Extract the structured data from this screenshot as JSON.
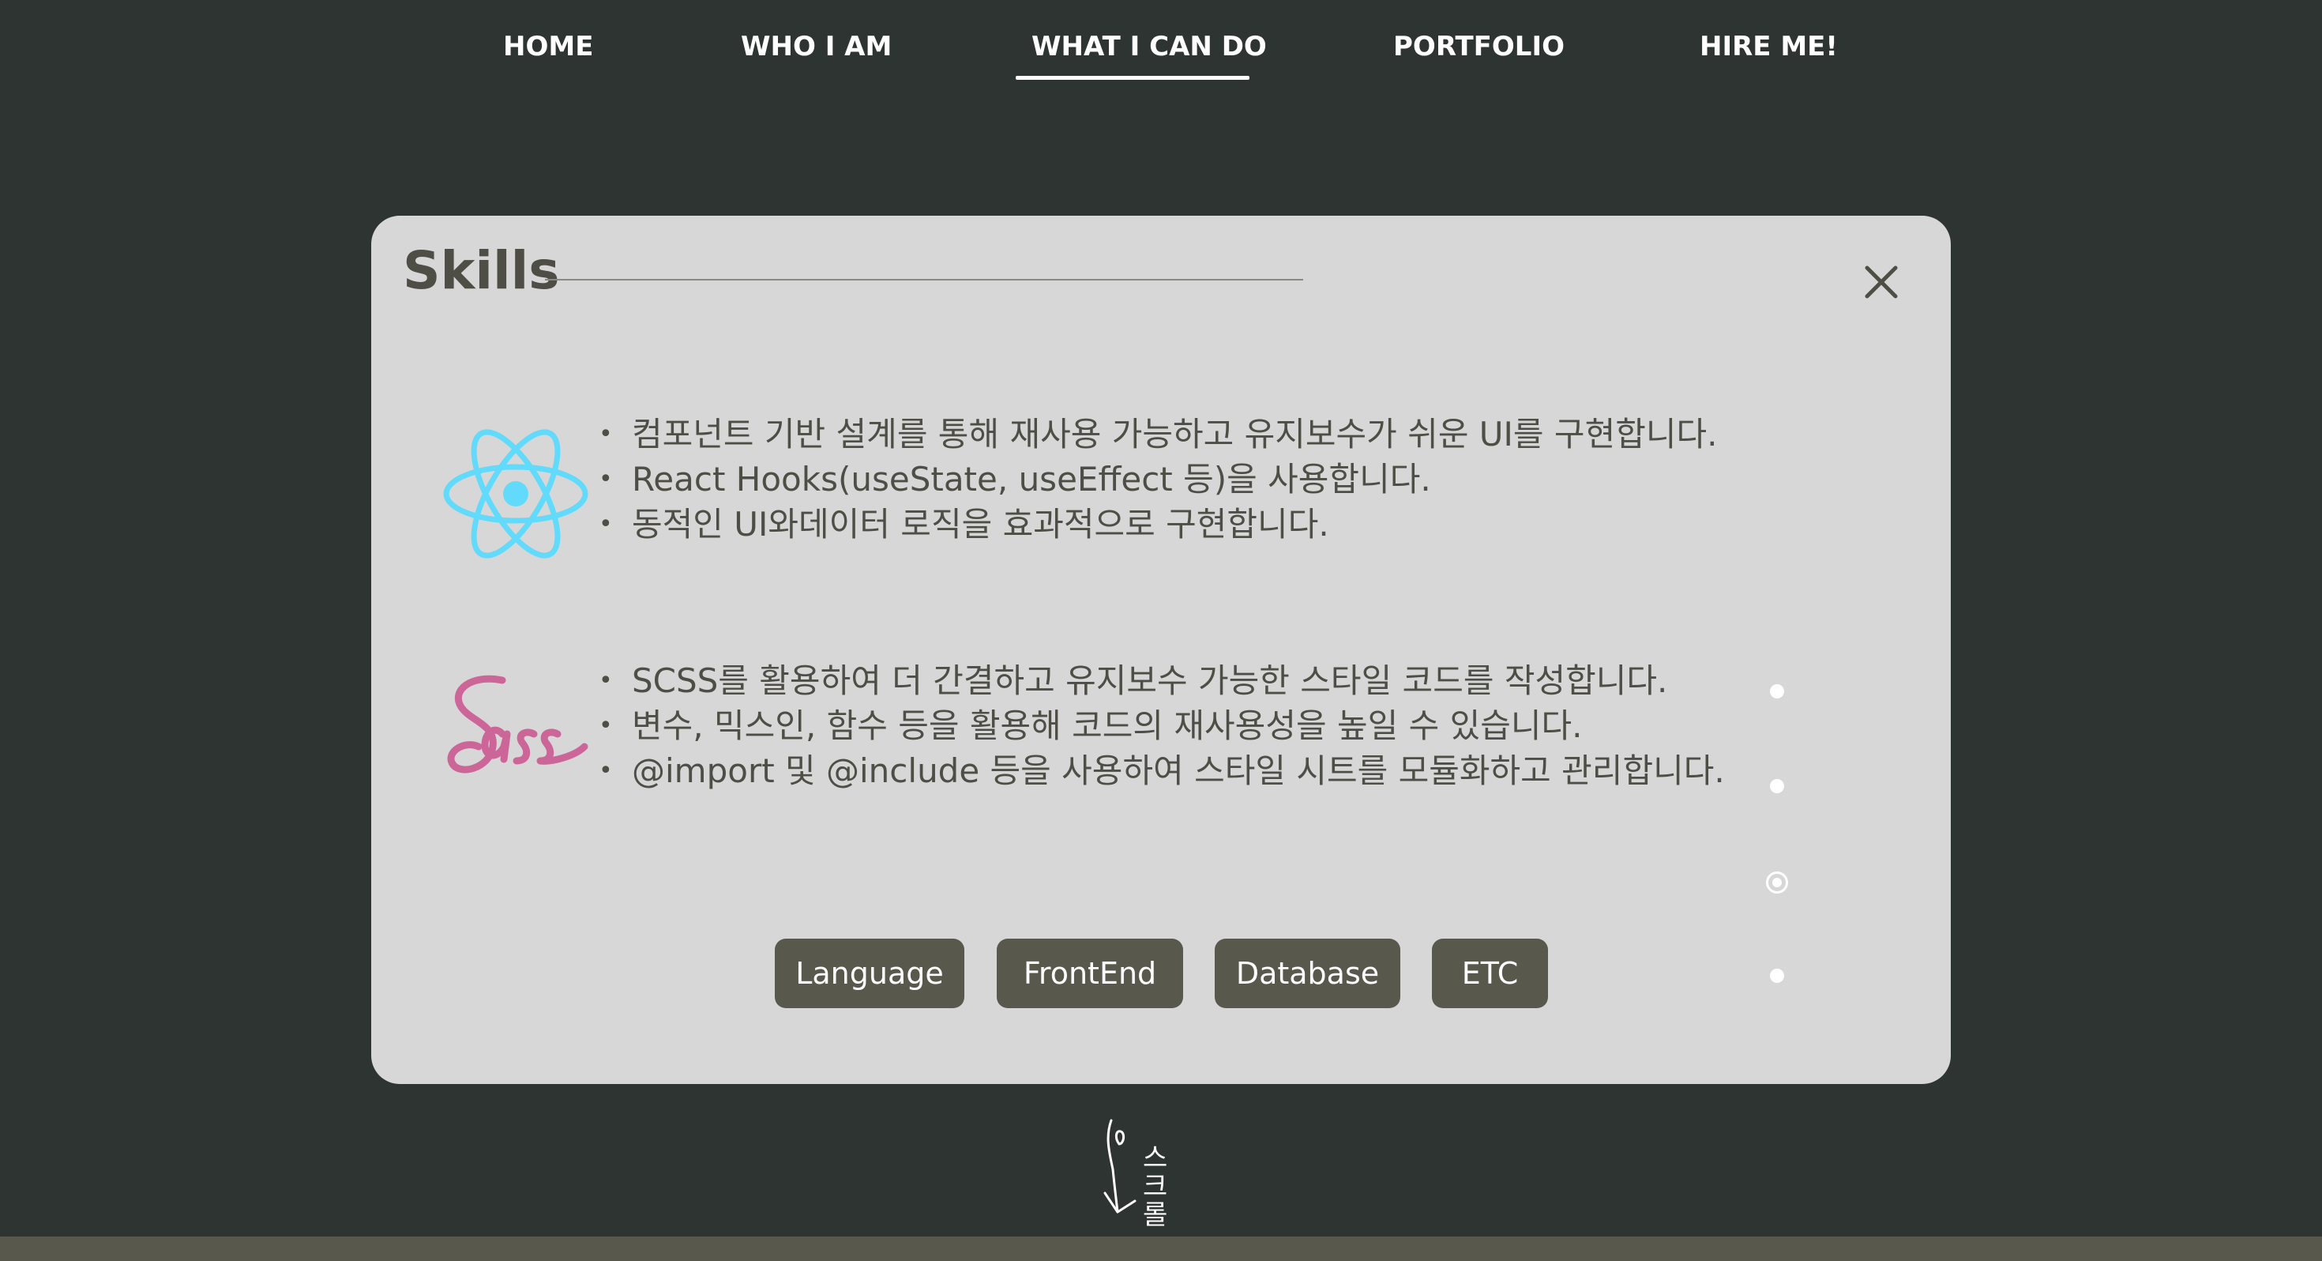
{
  "nav": {
    "items": [
      {
        "label": "HOME",
        "active": false
      },
      {
        "label": "WHO I AM",
        "active": false
      },
      {
        "label": "WHAT I CAN DO",
        "active": true
      },
      {
        "label": "PORTFOLIO",
        "active": false
      },
      {
        "label": "HIRE ME!",
        "active": false
      }
    ]
  },
  "modal": {
    "title": "Skills",
    "close_icon": "close-icon",
    "skills": [
      {
        "logo": "react-logo-icon",
        "bullets": [
          "컴포넌트 기반 설계를 통해 재사용 가능하고 유지보수가 쉬운 UI를 구현합니다.",
          "React Hooks(useState, useEffect 등)을 사용합니다.",
          "동적인 UI와데이터 로직을 효과적으로 구현합니다."
        ]
      },
      {
        "logo": "sass-logo-icon",
        "bullets": [
          "SCSS를 활용하여 더 간결하고 유지보수 가능한 스타일 코드를 작성합니다.",
          "변수, 믹스인, 함수 등을 활용해 코드의 재사용성을 높일 수 있습니다.",
          "@import 및 @include 등을 사용하여 스타일 시트를 모듈화하고 관리합니다."
        ]
      }
    ],
    "pagination": {
      "count": 4,
      "active_index": 2
    },
    "categories": [
      "Language",
      "FrontEnd",
      "Database",
      "ETC"
    ]
  },
  "scroll_hint": {
    "text": "스크롤"
  },
  "colors": {
    "background": "#2d3431",
    "modal": "#d7d7d7",
    "text": "#4e4e46",
    "button": "#58584c",
    "react": "#61dafb",
    "sass": "#cc6699"
  }
}
